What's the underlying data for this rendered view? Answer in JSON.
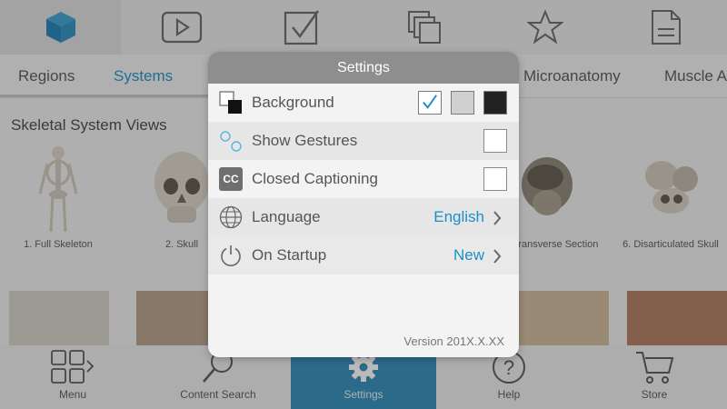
{
  "toolbar": {
    "icons": [
      "cube-icon",
      "play-icon",
      "checkmark-icon",
      "layers-icon",
      "star-icon",
      "document-icon"
    ],
    "active_index": 0
  },
  "tabs": {
    "items": [
      "Regions",
      "Systems",
      "Microanatomy",
      "Muscle A"
    ],
    "active": "Systems"
  },
  "content": {
    "section_title": "Skeletal System Views",
    "thumbnails": [
      {
        "caption": "1. Full Skeleton"
      },
      {
        "caption": "2. Skull"
      },
      {
        "caption": "kull, Transverse Section"
      },
      {
        "caption": "6. Disarticulated Skull"
      }
    ]
  },
  "bottom_nav": {
    "items": [
      {
        "label": "Menu",
        "icon": "grid-menu-icon"
      },
      {
        "label": "Content Search",
        "icon": "search-icon"
      },
      {
        "label": "Settings",
        "icon": "gear-icon"
      },
      {
        "label": "Help",
        "icon": "help-icon"
      },
      {
        "label": "Store",
        "icon": "cart-icon"
      }
    ],
    "active": "Settings"
  },
  "settings": {
    "title": "Settings",
    "background_label": "Background",
    "background_options": [
      "light",
      "gray",
      "black"
    ],
    "background_selected": "light",
    "gestures_label": "Show Gestures",
    "gestures_checked": false,
    "captions_label": "Closed Captioning",
    "captions_icon_text": "CC",
    "captions_checked": false,
    "language_label": "Language",
    "language_value": "English",
    "startup_label": "On Startup",
    "startup_value": "New",
    "version": "Version 201X.X.XX"
  },
  "colors": {
    "accent": "#1a8fc8",
    "active_nav": "#2e8ab8",
    "modal_header": "#8e8e8e"
  }
}
